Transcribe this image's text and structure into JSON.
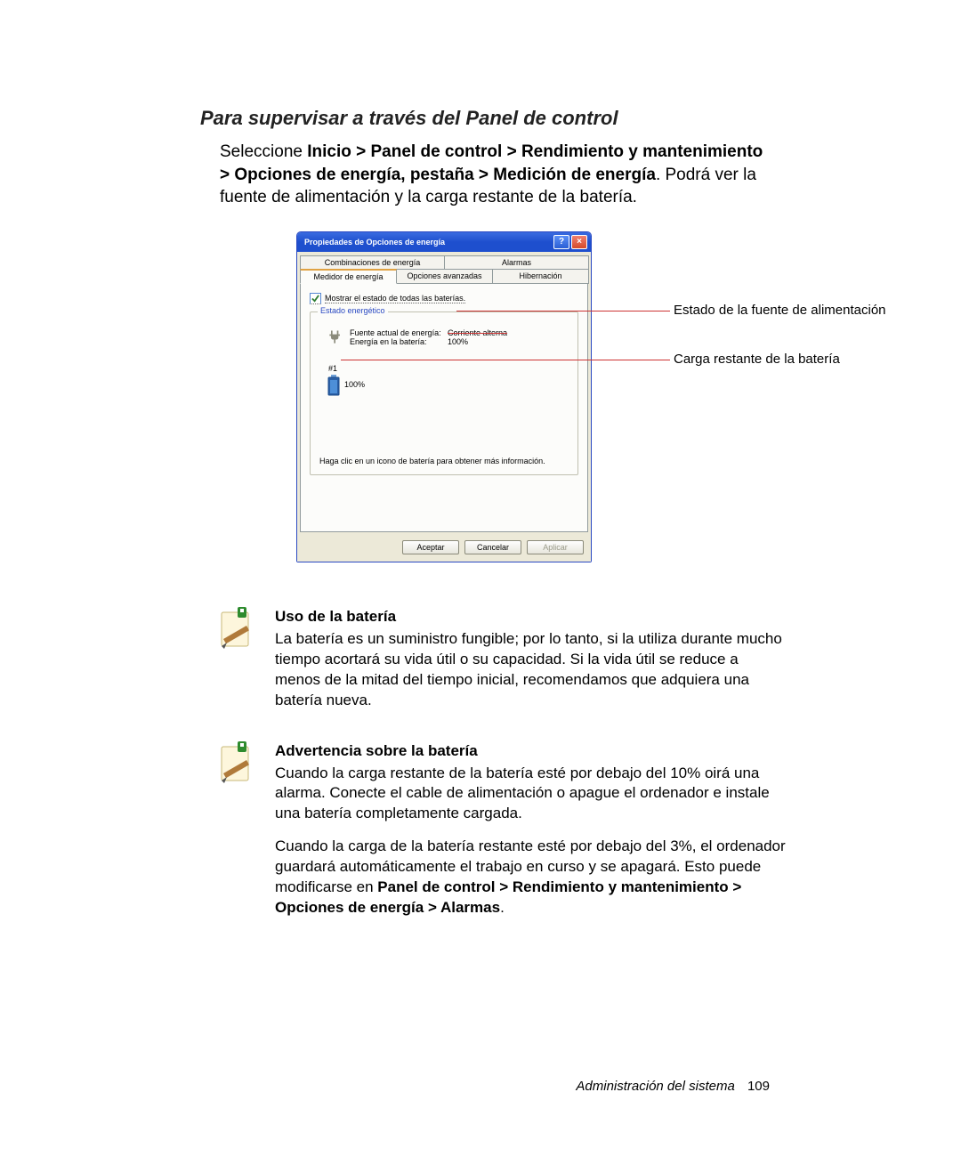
{
  "section_title": "Para supervisar a través del Panel de control",
  "intro": {
    "prefix": "Seleccione ",
    "bold": "Inicio > Panel de control > Rendimiento y mantenimiento > Opciones de energía, pestaña > Medición de energía",
    "suffix": ". Podrá ver la fuente de alimentación y la carga restante de la batería."
  },
  "dialog": {
    "title": "Propiedades de Opciones de energía",
    "tabs_top": [
      "Combinaciones de energía",
      "Alarmas"
    ],
    "tabs_bottom": [
      "Medidor de energía",
      "Opciones avanzadas",
      "Hibernación"
    ],
    "checkbox_label": "Mostrar el estado de todas las baterías.",
    "group_legend": "Estado energético",
    "kv": {
      "k1": "Fuente actual de energía:",
      "v1": "Corriente alterna",
      "k2": "Energía en la batería:",
      "v2": "100%"
    },
    "battery": {
      "hash": "#1",
      "pct": "100%"
    },
    "hint": "Haga clic en un icono de batería para obtener más información.",
    "buttons": {
      "ok": "Aceptar",
      "cancel": "Cancelar",
      "apply": "Aplicar"
    }
  },
  "callouts": {
    "power_source": "Estado de la fuente de alimentación",
    "remaining": "Carga restante de la batería"
  },
  "note1": {
    "title": "Uso de la batería",
    "text": "La batería es un suministro fungible; por lo tanto, si la utiliza durante mucho tiempo acortará su vida útil o su capacidad. Si la vida útil se reduce a menos de la mitad del tiempo inicial, recomendamos que adquiera una batería nueva."
  },
  "note2": {
    "title": "Advertencia sobre la batería",
    "p1": "Cuando la carga restante de la batería esté por debajo del 10% oirá una alarma. Conecte el cable de alimentación o apague el ordenador e instale una batería completamente cargada.",
    "p2_prefix": "Cuando la carga de la batería restante esté por debajo del 3%, el ordenador guardará automáticamente el trabajo en curso y se apagará. Esto puede modificarse en ",
    "p2_bold": "Panel de control > Rendimiento y mantenimiento > Opciones de energía > Alarmas",
    "p2_suffix": "."
  },
  "footer": {
    "section": "Administración del sistema",
    "page": "109"
  }
}
